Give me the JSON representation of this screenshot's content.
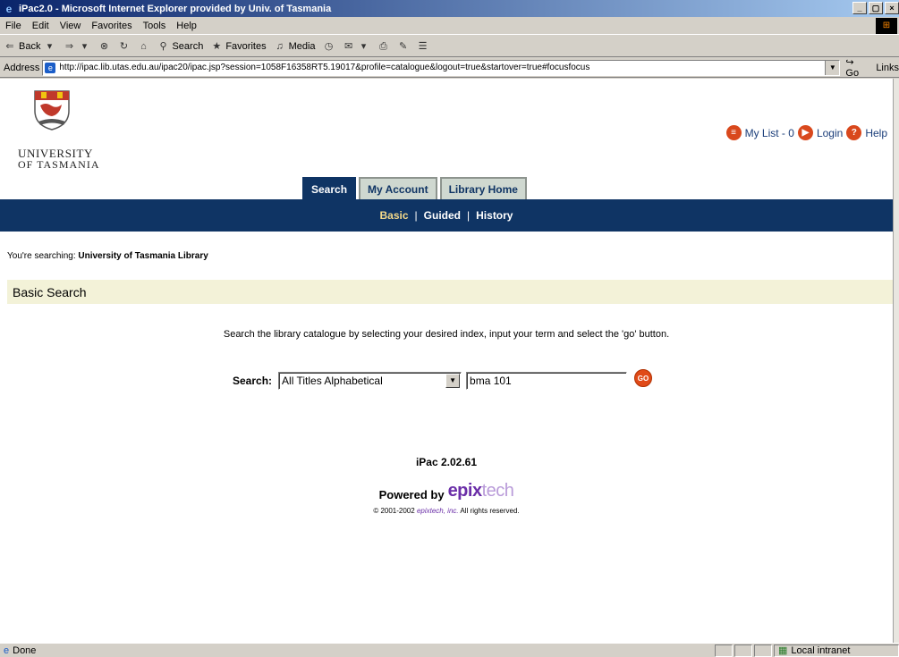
{
  "window": {
    "title": "iPac2.0 - Microsoft Internet Explorer provided by Univ. of Tasmania",
    "controls": [
      "_",
      "▢",
      "×"
    ]
  },
  "menu": [
    "File",
    "Edit",
    "View",
    "Favorites",
    "Tools",
    "Help"
  ],
  "toolbar": {
    "back": "Back",
    "search": "Search",
    "favorites": "Favorites",
    "media": "Media"
  },
  "address": {
    "label": "Address",
    "url": "http://ipac.lib.utas.edu.au/ipac20/ipac.jsp?session=1058F16358RT5.19017&profile=catalogue&logout=true&startover=true#focusfocus",
    "go": "Go",
    "links": "Links"
  },
  "page": {
    "university_line1": "UNIVERSITY",
    "university_line2": "OF TASMANIA",
    "my_list": "My List - 0",
    "login": "Login",
    "help": "Help",
    "tabs": [
      {
        "label": "Search"
      },
      {
        "label": "My Account"
      },
      {
        "label": "Library Home"
      }
    ],
    "subnav": [
      {
        "label": "Basic"
      },
      {
        "label": "Guided"
      },
      {
        "label": "History"
      }
    ],
    "searching_prefix": "You're searching:",
    "searching_library": "University of Tasmania Library",
    "section_title": "Basic Search",
    "instructions": "Search the library catalogue by selecting your desired index, input your term and select the 'go' button.",
    "search_label": "Search:",
    "index_selected": "All Titles Alphabetical",
    "search_term": "bma 101",
    "go_button": "GO",
    "version": "iPac 2.02.61",
    "powered_by": "Powered by",
    "brand_bold": "epix",
    "brand_light": "tech",
    "copyright_prefix": "© 2001-2002",
    "copyright_company": "epixtech, inc.",
    "copyright_suffix": "All rights reserved."
  },
  "status": {
    "text": "Done",
    "zone": "Local intranet"
  }
}
